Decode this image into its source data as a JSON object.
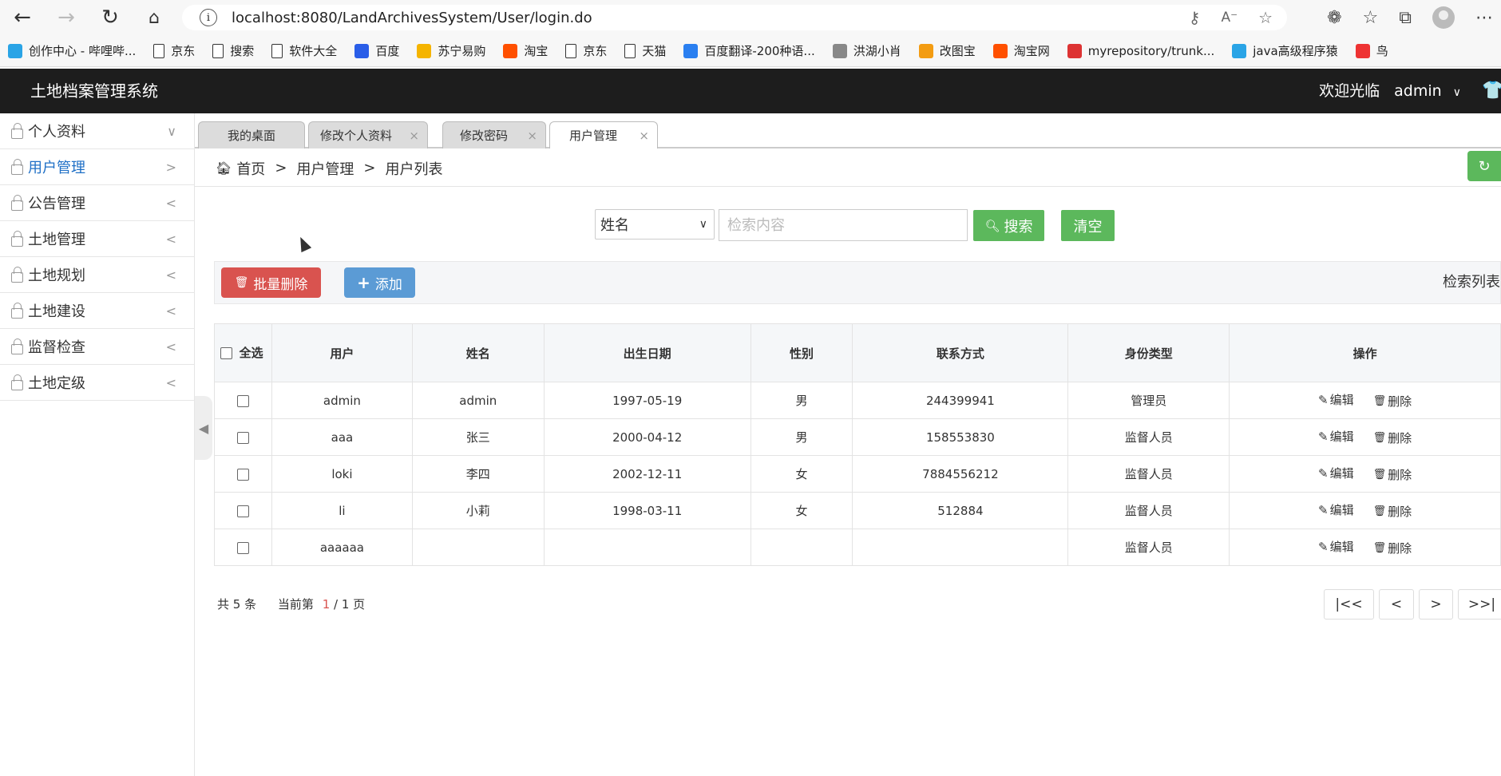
{
  "browser": {
    "url": "localhost:8080/LandArchivesSystem/User/login.do",
    "bookmarks": [
      {
        "label": "创作中心 - 哔哩哔...",
        "icon": "bilibili-icon",
        "color": "#2aa4e6"
      },
      {
        "label": "京东",
        "icon": "page-icon"
      },
      {
        "label": "搜索",
        "icon": "page-icon"
      },
      {
        "label": "软件大全",
        "icon": "page-icon"
      },
      {
        "label": "百度",
        "icon": "baidu-icon",
        "color": "#2a5ee8"
      },
      {
        "label": "苏宁易购",
        "icon": "suning-icon",
        "color": "#f5b400"
      },
      {
        "label": "淘宝",
        "icon": "taobao-icon",
        "color": "#ff5000"
      },
      {
        "label": "京东",
        "icon": "page-icon"
      },
      {
        "label": "天猫",
        "icon": "page-icon"
      },
      {
        "label": "百度翻译-200种语...",
        "icon": "translate-icon",
        "color": "#2a7ff0"
      },
      {
        "label": "洪湖小肖",
        "icon": "bird-icon",
        "color": "#888"
      },
      {
        "label": "改图宝",
        "icon": "gaitubao-icon",
        "color": "#f39c12"
      },
      {
        "label": "淘宝网",
        "icon": "taobao-icon",
        "color": "#ff5000"
      },
      {
        "label": "myrepository/trunk...",
        "icon": "chrome-icon",
        "color": "#d33"
      },
      {
        "label": "java高级程序猿",
        "icon": "bilibili-icon",
        "color": "#2aa4e6"
      },
      {
        "label": "鸟",
        "icon": "bird-icon",
        "color": "#e33"
      }
    ]
  },
  "header": {
    "title": "土地档案管理系统",
    "welcome": "欢迎光临",
    "user": "admin"
  },
  "sidebar": {
    "items": [
      {
        "label": "个人资料",
        "arrow": "∨",
        "active": false
      },
      {
        "label": "用户管理",
        "arrow": ">",
        "active": true
      },
      {
        "label": "公告管理",
        "arrow": "<",
        "active": false
      },
      {
        "label": "土地管理",
        "arrow": "<",
        "active": false
      },
      {
        "label": "土地规划",
        "arrow": "<",
        "active": false
      },
      {
        "label": "土地建设",
        "arrow": "<",
        "active": false
      },
      {
        "label": "监督检查",
        "arrow": "<",
        "active": false
      },
      {
        "label": "土地定级",
        "arrow": "<",
        "active": false
      }
    ]
  },
  "tabs": [
    {
      "label": "我的桌面"
    },
    {
      "label": "修改个人资料"
    },
    {
      "label": "修改密码"
    },
    {
      "label": "用户管理"
    }
  ],
  "breadcrumb": {
    "home": "首页",
    "sep": ">",
    "level1": "用户管理",
    "level2": "用户列表"
  },
  "search": {
    "select_value": "姓名",
    "placeholder": "检索内容",
    "search_label": "搜索",
    "clear_label": "清空"
  },
  "actions": {
    "batch_delete": "批量删除",
    "add": "添加",
    "result_label": "检索列表"
  },
  "table": {
    "select_all": "全选",
    "columns": [
      "用户",
      "姓名",
      "出生日期",
      "性别",
      "联系方式",
      "身份类型",
      "操作"
    ],
    "edit_label": "编辑",
    "delete_label": "删除",
    "rows": [
      {
        "user": "admin",
        "name": "admin",
        "birth": "1997-05-19",
        "gender": "男",
        "contact": "244399941",
        "role": "管理员"
      },
      {
        "user": "aaa",
        "name": "张三",
        "birth": "2000-04-12",
        "gender": "男",
        "contact": "158553830",
        "role": "监督人员"
      },
      {
        "user": "loki",
        "name": "李四",
        "birth": "2002-12-11",
        "gender": "女",
        "contact": "7884556212",
        "role": "监督人员"
      },
      {
        "user": "li",
        "name": "小莉",
        "birth": "1998-03-11",
        "gender": "女",
        "contact": "512884",
        "role": "监督人员"
      },
      {
        "user": "aaaaaa",
        "name": "",
        "birth": "",
        "gender": "",
        "contact": "",
        "role": "监督人员"
      }
    ]
  },
  "pagination": {
    "total_prefix": "共",
    "total": "5",
    "total_suffix": "条",
    "current_prefix": "当前第",
    "current": "1",
    "of": "/ 1 页",
    "first": "|<<",
    "prev": "<",
    "next": ">",
    "last": ">>|"
  },
  "colors": {
    "header_bg": "#1d1d1d",
    "green": "#5cb85c",
    "red": "#d9534f",
    "blue": "#5b9bd5",
    "active_link": "#1e6fc6"
  }
}
